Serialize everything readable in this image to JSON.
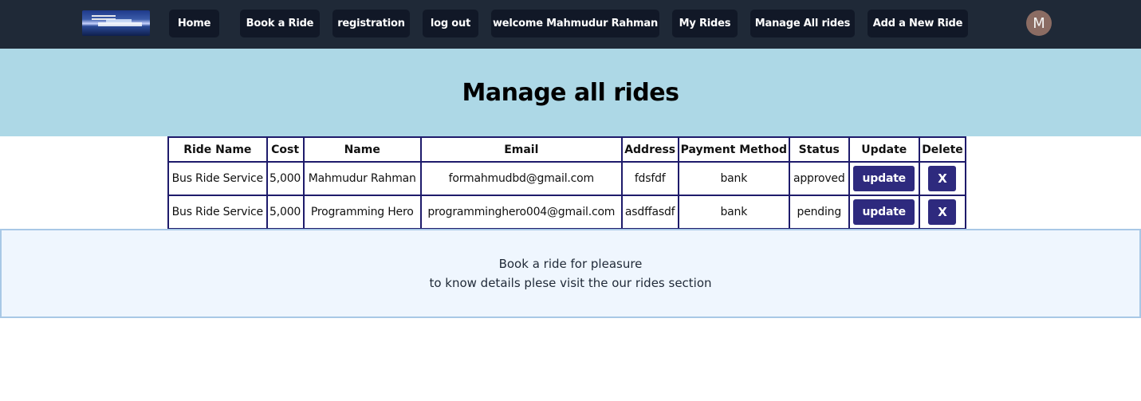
{
  "nav": {
    "home": "Home",
    "book_ride": "Book a Ride",
    "registration": "registration",
    "logout": "log out",
    "welcome": "welcome Mahmudur Rahman",
    "my_rides": "My Rides",
    "manage_all": "Manage All rides",
    "add_ride": "Add a New Ride",
    "avatar_letter": "M"
  },
  "hero": {
    "title": "Manage all rides"
  },
  "table": {
    "headers": [
      "Ride Name",
      "Cost",
      "Name",
      "Email",
      "Address",
      "Payment Method",
      "Status",
      "Update",
      "Delete"
    ],
    "rows": [
      {
        "ride_name": "Bus Ride Service",
        "cost": "5,000",
        "name": "Mahmudur Rahman",
        "email": "formahmudbd@gmail.com",
        "address": "fdsfdf",
        "payment": "bank",
        "status": "approved",
        "update": "update",
        "delete": "X"
      },
      {
        "ride_name": "Bus Ride Service",
        "cost": "5,000",
        "name": "Programming Hero",
        "email": "programminghero004@gmail.com",
        "address": "asdffasdf",
        "payment": "bank",
        "status": "pending",
        "update": "update",
        "delete": "X"
      }
    ]
  },
  "footer": {
    "line1": "Book a ride for pleasure",
    "line2": "to know details plese visit the our rides section"
  },
  "colors": {
    "navbar_bg": "#1f2937",
    "nav_button_bg": "#111827",
    "hero_bg": "#add8e6",
    "table_border": "#1e1b6b",
    "action_button": "#2e2a7e",
    "footer_bg": "#eff6fe"
  }
}
